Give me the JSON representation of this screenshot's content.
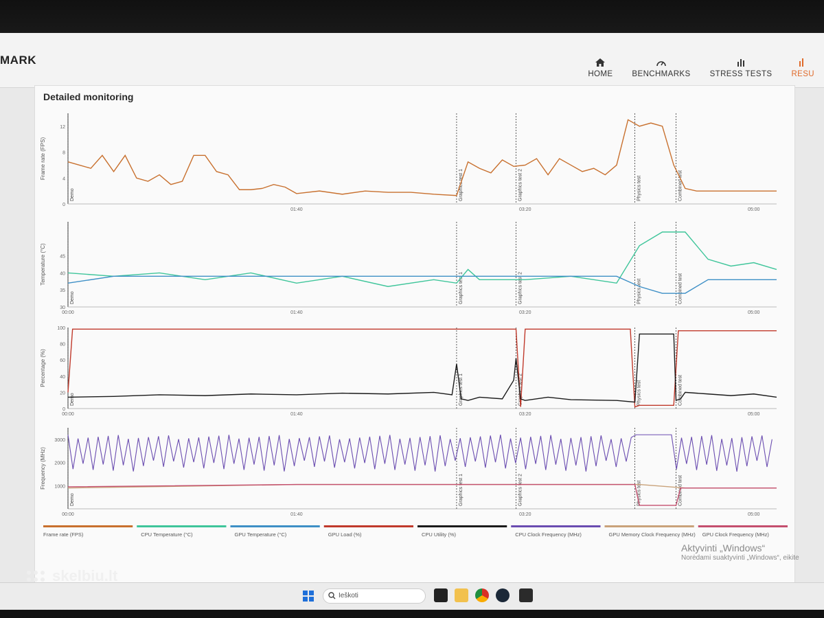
{
  "app": {
    "logo": "MARK"
  },
  "nav": [
    {
      "label": "HOME",
      "icon": "home-icon"
    },
    {
      "label": "BENCHMARKS",
      "icon": "gauge-icon"
    },
    {
      "label": "STRESS TESTS",
      "icon": "bar-chart-icon"
    },
    {
      "label": "RESU",
      "icon": "results-icon",
      "active": true
    }
  ],
  "panel": {
    "title": "Detailed monitoring"
  },
  "colors": {
    "frame_rate": "#c8702e",
    "cpu_temp": "#3ec59a",
    "gpu_temp": "#3d8fc6",
    "gpu_load": "#c0392b",
    "cpu_util": "#1a1a1a",
    "cpu_clock": "#6a4cb0",
    "gpu_mem_clock": "#c9a27a",
    "gpu_clock": "#c44e6e"
  },
  "chart_data": [
    {
      "type": "line",
      "ylabel": "Frame rate (FPS)",
      "yticks": [
        "0",
        "4",
        "8",
        "12"
      ],
      "ylim": [
        0,
        14
      ],
      "xticks": [
        "01:40",
        "03:20",
        "05:00"
      ],
      "markers": [
        "Demo",
        "Graphics test 1",
        "Graphics test 2",
        "Physics test",
        "Combined test"
      ],
      "series": [
        {
          "name": "Frame rate (FPS)",
          "x": [
            0,
            5,
            10,
            15,
            20,
            25,
            30,
            35,
            40,
            45,
            50,
            55,
            60,
            65,
            70,
            75,
            80,
            85,
            90,
            95,
            100,
            110,
            120,
            130,
            140,
            150,
            160,
            170,
            175,
            180,
            185,
            190,
            195,
            200,
            205,
            210,
            215,
            220,
            225,
            230,
            235,
            240,
            245,
            250,
            255,
            260,
            265,
            270,
            275,
            280,
            285,
            290,
            295,
            300,
            305,
            310
          ],
          "values": [
            6.5,
            6,
            5.5,
            7.5,
            5,
            7.5,
            4,
            3.5,
            4.5,
            3,
            3.5,
            7.5,
            7.5,
            5,
            4.5,
            2.2,
            2.2,
            2.4,
            3,
            2.6,
            1.6,
            2,
            1.5,
            2,
            1.8,
            1.8,
            1.5,
            1.3,
            6.5,
            5.5,
            4.8,
            6.8,
            5.8,
            6,
            7,
            4.5,
            7,
            6,
            5,
            5.5,
            4.5,
            6,
            13,
            12,
            12.5,
            12,
            6,
            2.4,
            2,
            2,
            2,
            2,
            2,
            2,
            2,
            2
          ]
        }
      ]
    },
    {
      "type": "line",
      "ylabel": "Temperature (°C)",
      "yticks": [
        "30",
        "35",
        "40",
        "45"
      ],
      "ylim": [
        30,
        55
      ],
      "xticks": [
        "00:00",
        "01:40",
        "03:20",
        "05:00"
      ],
      "markers": [
        "Demo",
        "Graphics test 1",
        "Graphics test 2",
        "Physics test",
        "Combined test"
      ],
      "series": [
        {
          "name": "CPU Temperature (°C)",
          "x": [
            0,
            20,
            40,
            60,
            80,
            100,
            120,
            140,
            160,
            170,
            175,
            180,
            200,
            220,
            240,
            250,
            260,
            270,
            280,
            290,
            300,
            310
          ],
          "values": [
            40,
            39,
            40,
            38,
            40,
            37,
            39,
            36,
            38,
            37,
            41,
            38,
            38,
            39,
            37,
            48,
            52,
            52,
            44,
            42,
            43,
            41
          ]
        },
        {
          "name": "GPU Temperature (°C)",
          "x": [
            0,
            20,
            40,
            60,
            80,
            100,
            120,
            140,
            160,
            170,
            175,
            180,
            200,
            220,
            240,
            250,
            260,
            270,
            280,
            290,
            300,
            310
          ],
          "values": [
            37,
            39,
            39,
            39,
            39,
            39,
            39,
            39,
            39,
            39,
            39,
            39,
            39,
            39,
            39,
            36,
            34,
            34,
            38,
            38,
            38,
            38
          ]
        }
      ]
    },
    {
      "type": "line",
      "ylabel": "Percentage (%)",
      "yticks": [
        "0",
        "20",
        "40",
        "60",
        "80",
        "100"
      ],
      "ylim": [
        0,
        100
      ],
      "xticks": [
        "00:00",
        "01:40",
        "03:20",
        "05:00"
      ],
      "markers": [
        "Demo",
        "Graphics test 1",
        "Graphics test 2",
        "Physics test",
        "Combined test"
      ],
      "series": [
        {
          "name": "GPU Load (%)",
          "x": [
            0,
            2,
            4,
            170,
            171,
            196,
            198,
            200,
            246,
            248,
            250,
            265,
            267,
            310
          ],
          "values": [
            20,
            98,
            98,
            98,
            98,
            98,
            2,
            98,
            98,
            2,
            4,
            4,
            96,
            96
          ]
        },
        {
          "name": "CPU Utility (%)",
          "x": [
            0,
            20,
            40,
            60,
            80,
            100,
            120,
            140,
            160,
            168,
            170,
            172,
            175,
            180,
            190,
            195,
            196,
            198,
            200,
            210,
            220,
            240,
            248,
            250,
            260,
            265,
            266,
            268,
            270,
            280,
            290,
            300,
            310
          ],
          "values": [
            14,
            15,
            17,
            16,
            18,
            17,
            19,
            18,
            20,
            17,
            55,
            12,
            10,
            14,
            12,
            35,
            62,
            12,
            10,
            14,
            11,
            10,
            8,
            92,
            92,
            92,
            10,
            12,
            20,
            18,
            16,
            18,
            14
          ]
        }
      ]
    },
    {
      "type": "line",
      "ylabel": "Frequency (MHz)",
      "yticks": [
        "1000",
        "2000",
        "3000"
      ],
      "ylim": [
        0,
        3500
      ],
      "xticks": [
        "00:00",
        "01:40",
        "03:20",
        "05:00"
      ],
      "markers": [
        "Demo",
        "Graphics test 1",
        "Graphics test 2",
        "Physics test",
        "Combined test"
      ],
      "series": [
        {
          "name": "CPU Clock Frequency (MHz)",
          "x": [
            0,
            310
          ],
          "values_summary": "oscillates 1600–3200",
          "values": [
            3200,
            1600
          ]
        },
        {
          "name": "GPU Memory Clock Frequency (MHz)",
          "x": [
            0,
            100,
            200,
            250,
            270,
            310
          ],
          "values": [
            900,
            1050,
            1050,
            1050,
            900,
            900
          ]
        },
        {
          "name": "GPU Clock Frequency (MHz)",
          "x": [
            0,
            100,
            200,
            248,
            250,
            266,
            268,
            310
          ],
          "values": [
            950,
            1050,
            1050,
            1050,
            150,
            150,
            900,
            900
          ]
        }
      ]
    }
  ],
  "legend": [
    {
      "label": "Frame rate (FPS)",
      "color": "#c8702e"
    },
    {
      "label": "CPU Temperature (°C)",
      "color": "#3ec59a"
    },
    {
      "label": "GPU Temperature (°C)",
      "color": "#3d8fc6"
    },
    {
      "label": "GPU Load (%)",
      "color": "#c0392b"
    },
    {
      "label": "CPU Utility (%)",
      "color": "#1a1a1a"
    },
    {
      "label": "CPU Clock Frequency (MHz)",
      "color": "#6a4cb0"
    },
    {
      "label": "GPU Memory Clock Frequency (MHz)",
      "color": "#c9a27a"
    },
    {
      "label": "GPU Clock Frequency (MHz)",
      "color": "#c44e6e"
    }
  ],
  "taskbar": {
    "search_placeholder": "Ieškoti"
  },
  "watermark": {
    "line1": "Aktyvinti „Windows“",
    "line2": "Norėdami suaktyvinti „Windows“, eikite"
  },
  "site_badge": "skelbiu.lt"
}
